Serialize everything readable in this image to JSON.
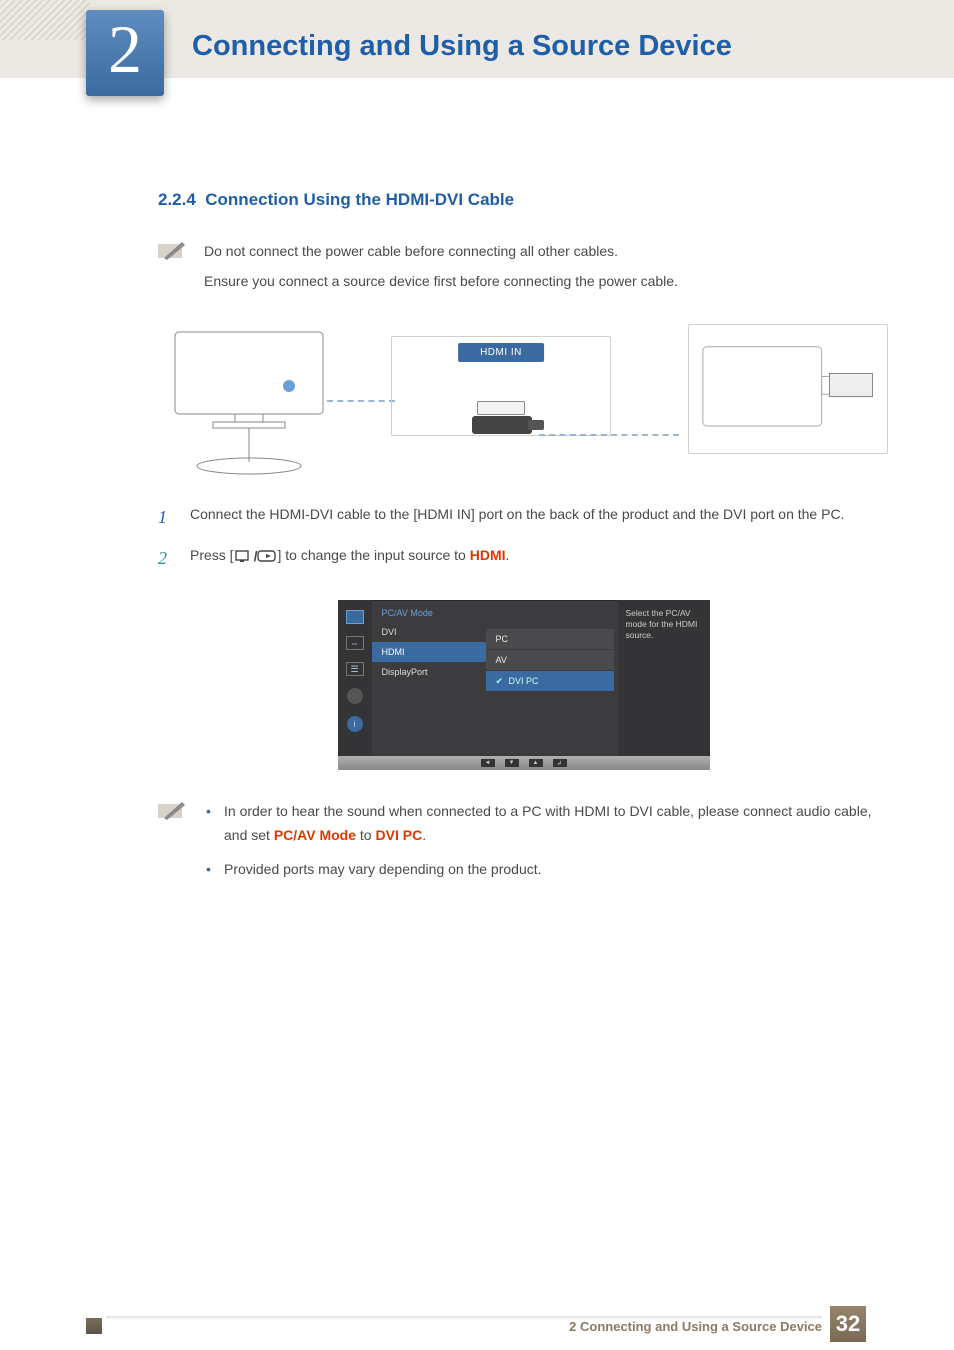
{
  "chapter": {
    "number": "2",
    "title": "Connecting and Using a Source Device"
  },
  "section": {
    "number": "2.2.4",
    "title": "Connection Using the HDMI-DVI Cable"
  },
  "note": {
    "line1": "Do not connect the power cable before connecting all other cables.",
    "line2": "Ensure you connect a source device first before connecting the power cable."
  },
  "diagram": {
    "hdmi_label": "HDMI IN"
  },
  "steps": {
    "s1_num": "1",
    "s1_text": "Connect the HDMI-DVI cable to the [HDMI IN] port on the back of the product and the DVI port on the PC.",
    "s2_num": "2",
    "s2_pre": "Press [",
    "s2_mid": "] to change the input source to ",
    "s2_kw": "HDMI",
    "s2_post": "."
  },
  "osd": {
    "title": "PC/AV Mode",
    "items": {
      "dvi": "DVI",
      "hdmi": "HDMI",
      "dp": "DisplayPort"
    },
    "sub": {
      "pc": "PC",
      "av": "AV",
      "dvipc": "DVI PC"
    },
    "desc": "Select the PC/AV mode for the HDMI source."
  },
  "bullets": {
    "b1_pre": "In order to hear the sound when connected to a PC with HDMI to DVI cable, please connect audio cable, and set ",
    "b1_kw1": "PC/AV Mode",
    "b1_mid": " to ",
    "b1_kw2": "DVI PC",
    "b1_post": ".",
    "b2": "Provided ports may vary depending on the product."
  },
  "footer": {
    "text": "2 Connecting and Using a Source Device",
    "page": "32"
  }
}
